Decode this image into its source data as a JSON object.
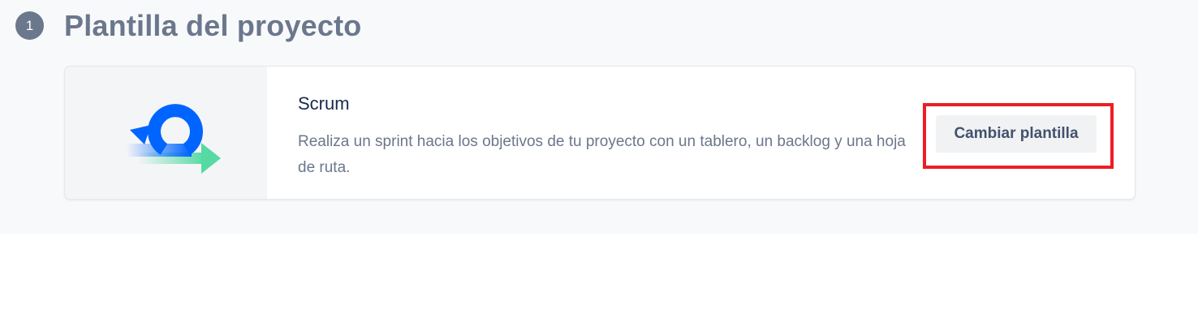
{
  "section": {
    "step_number": "1",
    "title": "Plantilla del proyecto"
  },
  "template": {
    "name": "Scrum",
    "description": "Realiza un sprint hacia los objetivos de tu proyecto con un tablero, un backlog y una hoja de ruta.",
    "illustration_icon": "scrum-cycle-arrow-icon",
    "change_button_label": "Cambiar plantilla"
  },
  "annotation": {
    "highlight_color": "#ee1c25"
  },
  "colors": {
    "cycle_blue": "#0065ff",
    "arrow_green": "#57d9a3",
    "muted_text": "#6b778c",
    "dark_text": "#172b4d"
  }
}
